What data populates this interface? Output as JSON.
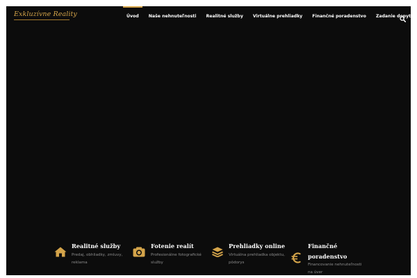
{
  "brand": {
    "logo_text": "Exkluzívne Reality"
  },
  "nav": {
    "items": [
      {
        "label": "Úvod",
        "active": true
      },
      {
        "label": "Naše nehnuteľnosti",
        "active": false
      },
      {
        "label": "Realitné služby",
        "active": false
      },
      {
        "label": "Virtuálne prehliadky",
        "active": false
      },
      {
        "label": "Finančné poradenstvo",
        "active": false
      },
      {
        "label": "Zadanie dopytu",
        "active": false
      }
    ],
    "search_icon": "search-icon"
  },
  "features": [
    {
      "icon": "home-icon",
      "title": "Realitné služby",
      "desc_1": "Predaj, obhliadky, zmluvy,",
      "desc_2": "reklama"
    },
    {
      "icon": "camera-icon",
      "title": "Fotenie realít",
      "desc_1": "Profesionálne fotografické",
      "desc_2": "služby"
    },
    {
      "icon": "layers-icon",
      "title": "Prehliadky online",
      "desc_1": "Virtuálna prehliadka objektu,",
      "desc_2": "pôdorys"
    },
    {
      "icon": "euro-icon",
      "title_1": "Finančné",
      "title_2": "poradenstvo",
      "desc_1": "Financovanie nehnuteľnosti",
      "desc_2": "na úver"
    }
  ],
  "colors": {
    "accent": "#d4a44a",
    "background": "#0c0c0c",
    "text": "#ffffff",
    "muted": "#8c8c8c"
  }
}
